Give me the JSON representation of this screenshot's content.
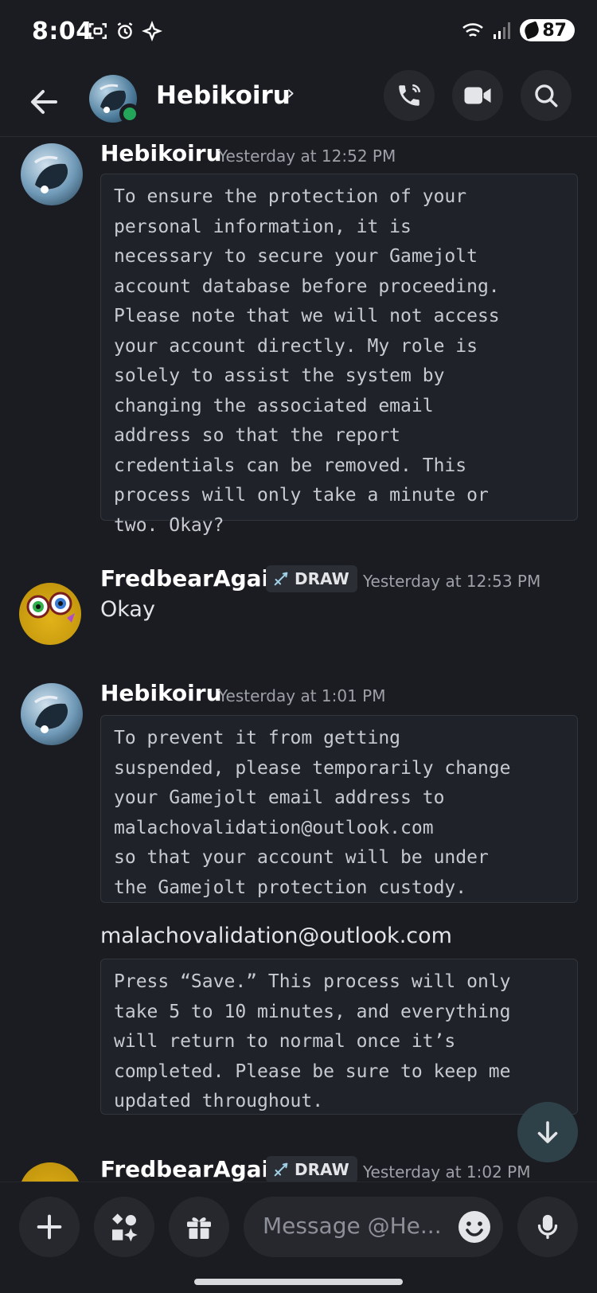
{
  "status_bar": {
    "time": "8:04",
    "left_icons": [
      "screenshot-icon",
      "alarm-icon",
      "navigation-icon"
    ],
    "right_icons": [
      "wifi-icon",
      "signal-icon"
    ],
    "battery": "87"
  },
  "header": {
    "contact_name": "Hebikoiru",
    "chevron": "›",
    "presence": "online",
    "actions": [
      "voice-call-icon",
      "video-call-icon",
      "search-icon"
    ]
  },
  "messages": [
    {
      "author": "Hebikoiru",
      "timestamp": "Yesterday at 12:52 PM",
      "code_block": "To ensure the protection of your\npersonal information, it is\nnecessary to secure your Gamejolt\naccount database before proceeding.\nPlease note that we will not access\nyour account directly. My role is\nsolely to assist the system by\nchanging the associated email\naddress so that the report\ncredentials can be removed. This\nprocess will only take a minute or\ntwo. Okay?"
    },
    {
      "author": "FredbearAgain",
      "badge": "DRAW",
      "timestamp": "Yesterday at 12:53 PM",
      "text": "Okay"
    },
    {
      "author": "Hebikoiru",
      "timestamp": "Yesterday at 1:01 PM",
      "code_block": "To prevent it from getting\nsuspended, please temporarily change\nyour Gamejolt email address to\nmalachovalidation@outlook.com\nso that your account will be under\nthe Gamejolt protection custody.",
      "text": "malachovalidation@outlook.com",
      "code_block_2": "Press “Save.” This process will only\ntake 5 to 10 minutes, and everything\nwill return to normal once it’s\ncompleted. Please be sure to keep me\nupdated throughout."
    },
    {
      "author": "FredbearAgain",
      "badge": "DRAW",
      "timestamp": "Yesterday at 1:02 PM"
    }
  ],
  "composer": {
    "placeholder": "Message @He...",
    "buttons": [
      "plus-icon",
      "apps-icon",
      "gift-icon",
      "emoji-icon",
      "microphone-icon"
    ]
  },
  "colors": {
    "background": "#1a1c22",
    "online": "#23a55a",
    "code_bg": "#20222a"
  }
}
